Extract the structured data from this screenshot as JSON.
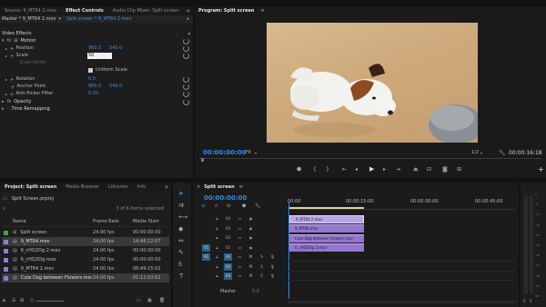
{
  "source_tabs": [
    "Source: 9_MT64 2.mov",
    "Effect Controls",
    "Audio Clip Mixer: Split screen"
  ],
  "effect_controls": {
    "master_label": "Master * 9_MT64 2.mov",
    "sequence_label": "Split screen * 9_MT64 2.mov",
    "video_effects": "Video Effects",
    "motion": "Motion",
    "position_label": "Position",
    "position_x": "960.0",
    "position_y": "540.0",
    "scale_label": "Scale",
    "scale_value": "50",
    "scale_width_label": "Scale Width",
    "uniform_scale": "Uniform Scale",
    "rotation_label": "Rotation",
    "rotation_value": "0.0",
    "anchor_label": "Anchor Point",
    "anchor_x": "960.0",
    "anchor_y": "540.0",
    "antiflicker_label": "Anti-flicker Filter",
    "antiflicker_value": "0.00",
    "opacity_label": "Opacity",
    "time_remapping": "Time Remapping"
  },
  "program": {
    "title": "Program: Split screen",
    "timecode": "00:00:00:00",
    "fit": "Fit",
    "resolution": "1/2",
    "duration": "00:00:16:18"
  },
  "transport_icons": [
    "marker-icon",
    "in-point-icon",
    "out-point-icon",
    "go-to-in-icon",
    "step-back-icon",
    "play-icon",
    "step-forward-icon",
    "go-to-out-icon",
    "lift-icon",
    "extract-icon",
    "export-frame-icon",
    "comparison-view-icon",
    "add-button-icon"
  ],
  "project": {
    "tabs": [
      "Project: Split screen",
      "Media Browser",
      "Libraries",
      "Info"
    ],
    "file": "Split Screen.prproj",
    "selection": "3 of 6 items selected",
    "columns": [
      "Name",
      "Frame Rate",
      "Media Start"
    ],
    "items": [
      {
        "name": "Split screen",
        "rate": "24.00 fps",
        "start": "00:00:00:00",
        "color": "#3fa54a"
      },
      {
        "name": "9_MT64.mov",
        "rate": "24.00 fps",
        "start": "14:48:12:07",
        "color": "#8f7fd6"
      },
      {
        "name": "6_cHQ2Og 2.mov",
        "rate": "24.00 fps",
        "start": "00:00:00:00",
        "color": "#8f7fd6"
      },
      {
        "name": "6_cHQ2Og.mov",
        "rate": "24.00 fps",
        "start": "00:00:00:00",
        "color": "#8f7fd6"
      },
      {
        "name": "9_MT64 2.mov",
        "rate": "24.00 fps",
        "start": "06:49:15:02",
        "color": "#8f7fd6"
      },
      {
        "name": "Cute Dog between Flowers.mov",
        "rate": "24.00 fps",
        "start": "01:12:03:02",
        "color": "#8f7fd6"
      }
    ]
  },
  "timeline": {
    "title": "Split screen",
    "timecode": "00:00:00:00",
    "ruler": [
      "00:00",
      "00:00:15:00",
      "00:00:30:00",
      "00:00:45:00"
    ],
    "video_tracks": [
      "V4",
      "V3",
      "V2",
      "V1"
    ],
    "audio_tracks": [
      "A1",
      "A2",
      "A3"
    ],
    "master_label": "Master",
    "master_value": "0.0",
    "clips": [
      "9_MT64 2.mov",
      "9_MT64.mov",
      "Cute Dog between Flowers.mov",
      "6_cHQ2Og 2.mov"
    ]
  },
  "meter_labels": [
    "0",
    "-6",
    "-12",
    "-18",
    "-24",
    "-30",
    "-36",
    "-42",
    "-48",
    "-54",
    "dB"
  ],
  "colors": {
    "accent": "#2d8ceb",
    "clip": "#a083d8",
    "playhead": "#2d8ceb"
  }
}
